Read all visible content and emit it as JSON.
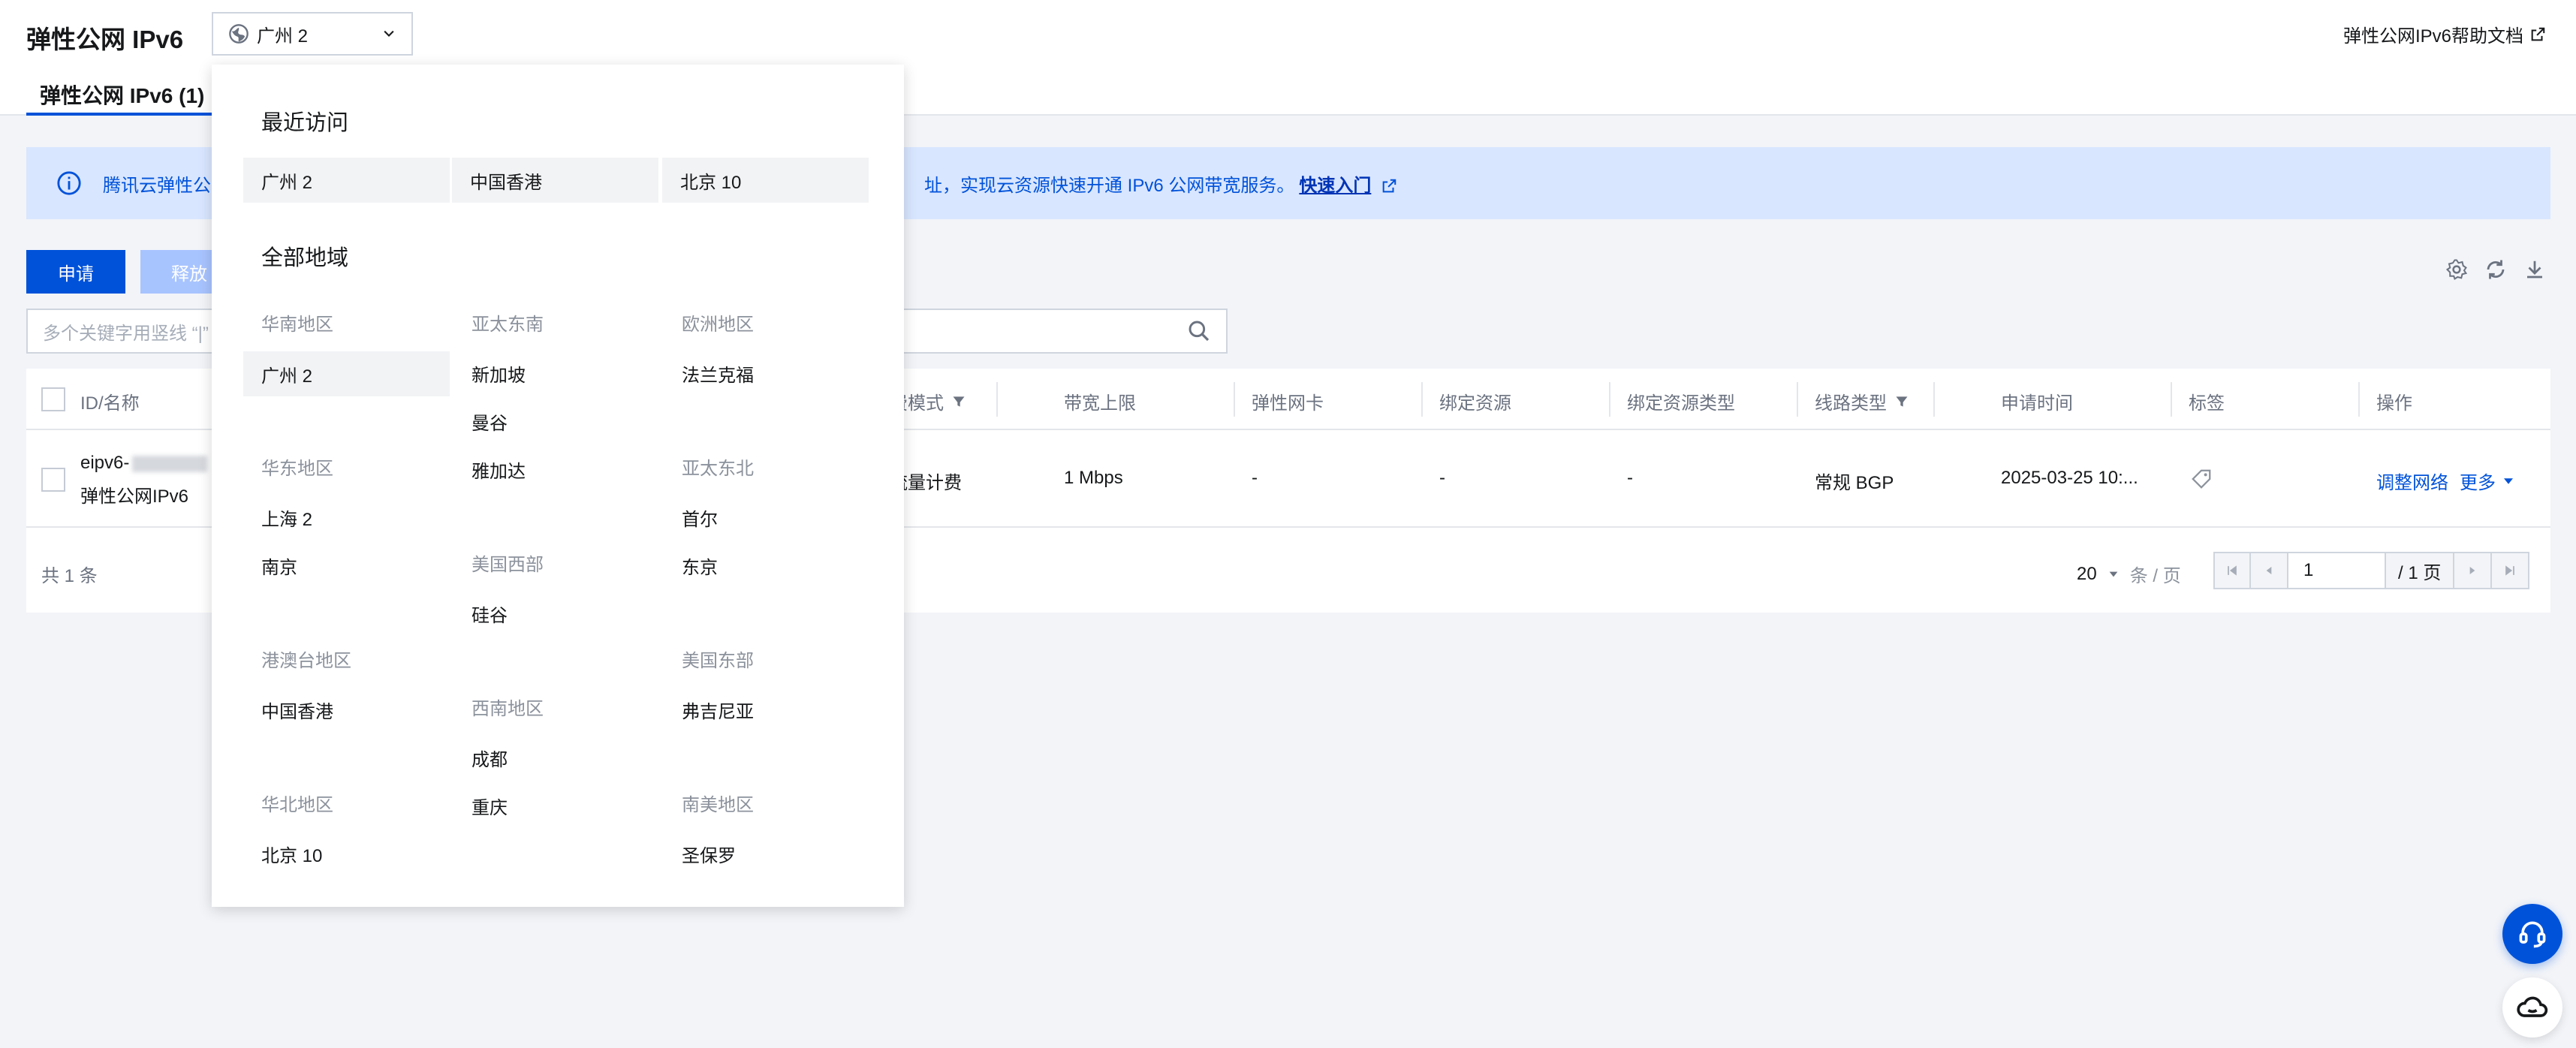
{
  "header": {
    "title": "弹性公网 IPv6",
    "region_value": "广州 2",
    "help_link": "弹性公网IPv6帮助文档",
    "tab_label": "弹性公网 IPv6 (1)"
  },
  "notice": {
    "text_left": "腾讯云弹性公",
    "text_right": "址，实现云资源快速开通 IPv6 公网带宽服务。",
    "quick_link": "快速入门"
  },
  "toolbar": {
    "apply_label": "申请",
    "release_label": "释放",
    "search_placeholder": "多个关键字用竖线 “|”"
  },
  "table": {
    "headers": {
      "id_name": "ID/名称",
      "billing": "费模式",
      "bandwidth": "带宽上限",
      "eni": "弹性网卡",
      "bound_resource": "绑定资源",
      "bound_type": "绑定资源类型",
      "line_type": "线路类型",
      "apply_time": "申请时间",
      "tags": "标签",
      "actions": "操作"
    },
    "row": {
      "id": "eipv6-",
      "name": "弹性公网IPv6",
      "billing": "流量计费",
      "bandwidth": "1 Mbps",
      "eni": "-",
      "bound_resource": "-",
      "bound_type": "-",
      "line_type": "常规 BGP",
      "apply_time": "2025-03-25 10:...",
      "action_adjust": "调整网络",
      "action_more": "更多"
    },
    "total": "共 1 条",
    "page_size": "20",
    "page_size_unit": "条 / 页",
    "page_input": "1",
    "page_total": "/ 1 页"
  },
  "dropdown": {
    "recent_title": "最近访问",
    "recent": [
      "广州 2",
      "中国香港",
      "北京 10"
    ],
    "all_title": "全部地域",
    "groups": {
      "south_china": "华南地区",
      "guangzhou2": "广州 2",
      "east_china": "华东地区",
      "shanghai2": "上海 2",
      "nanjing": "南京",
      "hk_macau_tw": "港澳台地区",
      "hongkong": "中国香港",
      "north_china": "华北地区",
      "beijing10": "北京 10",
      "se_asia": "亚太东南",
      "singapore": "新加坡",
      "bangkok": "曼谷",
      "jakarta": "雅加达",
      "us_west": "美国西部",
      "silicon_valley": "硅谷",
      "southwest": "西南地区",
      "chengdu": "成都",
      "chongqing": "重庆",
      "europe": "欧洲地区",
      "frankfurt": "法兰克福",
      "ne_asia": "亚太东北",
      "seoul": "首尔",
      "tokyo": "东京",
      "us_east": "美国东部",
      "virginia": "弗吉尼亚",
      "south_america": "南美地区",
      "sao_paulo": "圣保罗"
    }
  },
  "colors": {
    "primary": "#0052d9",
    "notice_bg": "#d9e6ff",
    "page_bg": "#f2f4f8"
  }
}
